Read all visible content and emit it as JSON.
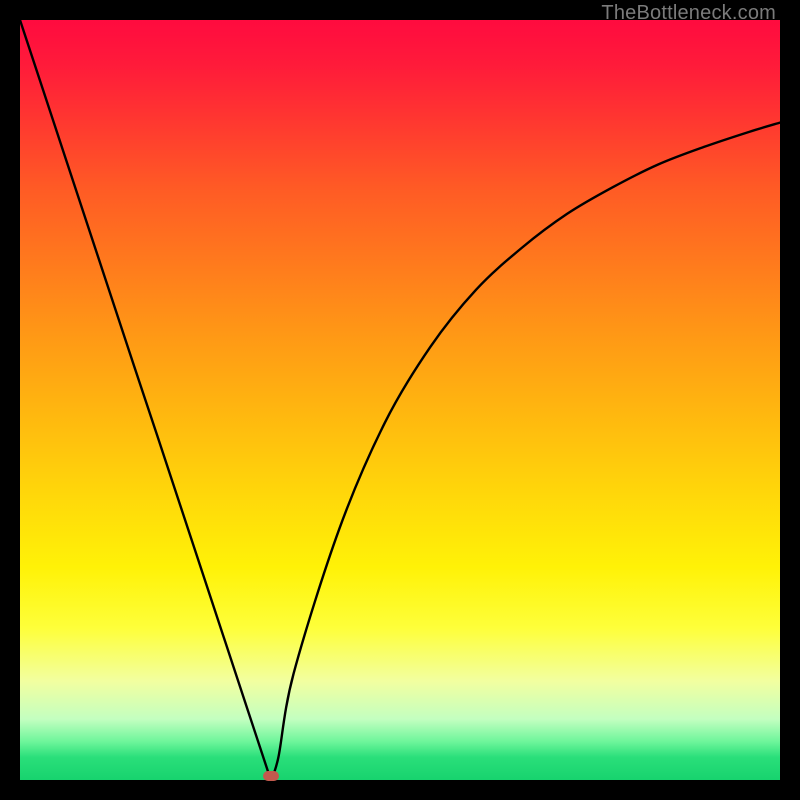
{
  "watermark": "TheBottleneck.com",
  "colors": {
    "frame_bg": "#000000",
    "curve_stroke": "#000000",
    "marker_fill": "#c25a4d"
  },
  "chart_data": {
    "type": "line",
    "title": "",
    "xlabel": "",
    "ylabel": "",
    "xlim": [
      0,
      100
    ],
    "ylim": [
      0,
      100
    ],
    "grid": false,
    "legend": false,
    "series": [
      {
        "name": "bottleneck-curve",
        "x": [
          0,
          3,
          6,
          9,
          12,
          15,
          18,
          21,
          24,
          27,
          30,
          33,
          34,
          36,
          42,
          48,
          54,
          60,
          66,
          72,
          78,
          84,
          90,
          96,
          100
        ],
        "y": [
          100,
          90.9,
          81.8,
          72.7,
          63.6,
          54.5,
          45.5,
          36.4,
          27.3,
          18.2,
          9.1,
          0,
          3,
          14,
          33,
          47,
          57,
          64.5,
          70,
          74.5,
          78,
          81,
          83.3,
          85.3,
          86.5
        ]
      }
    ],
    "annotations": [
      {
        "name": "minimum-marker",
        "x": 33,
        "y": 0.5
      }
    ]
  }
}
